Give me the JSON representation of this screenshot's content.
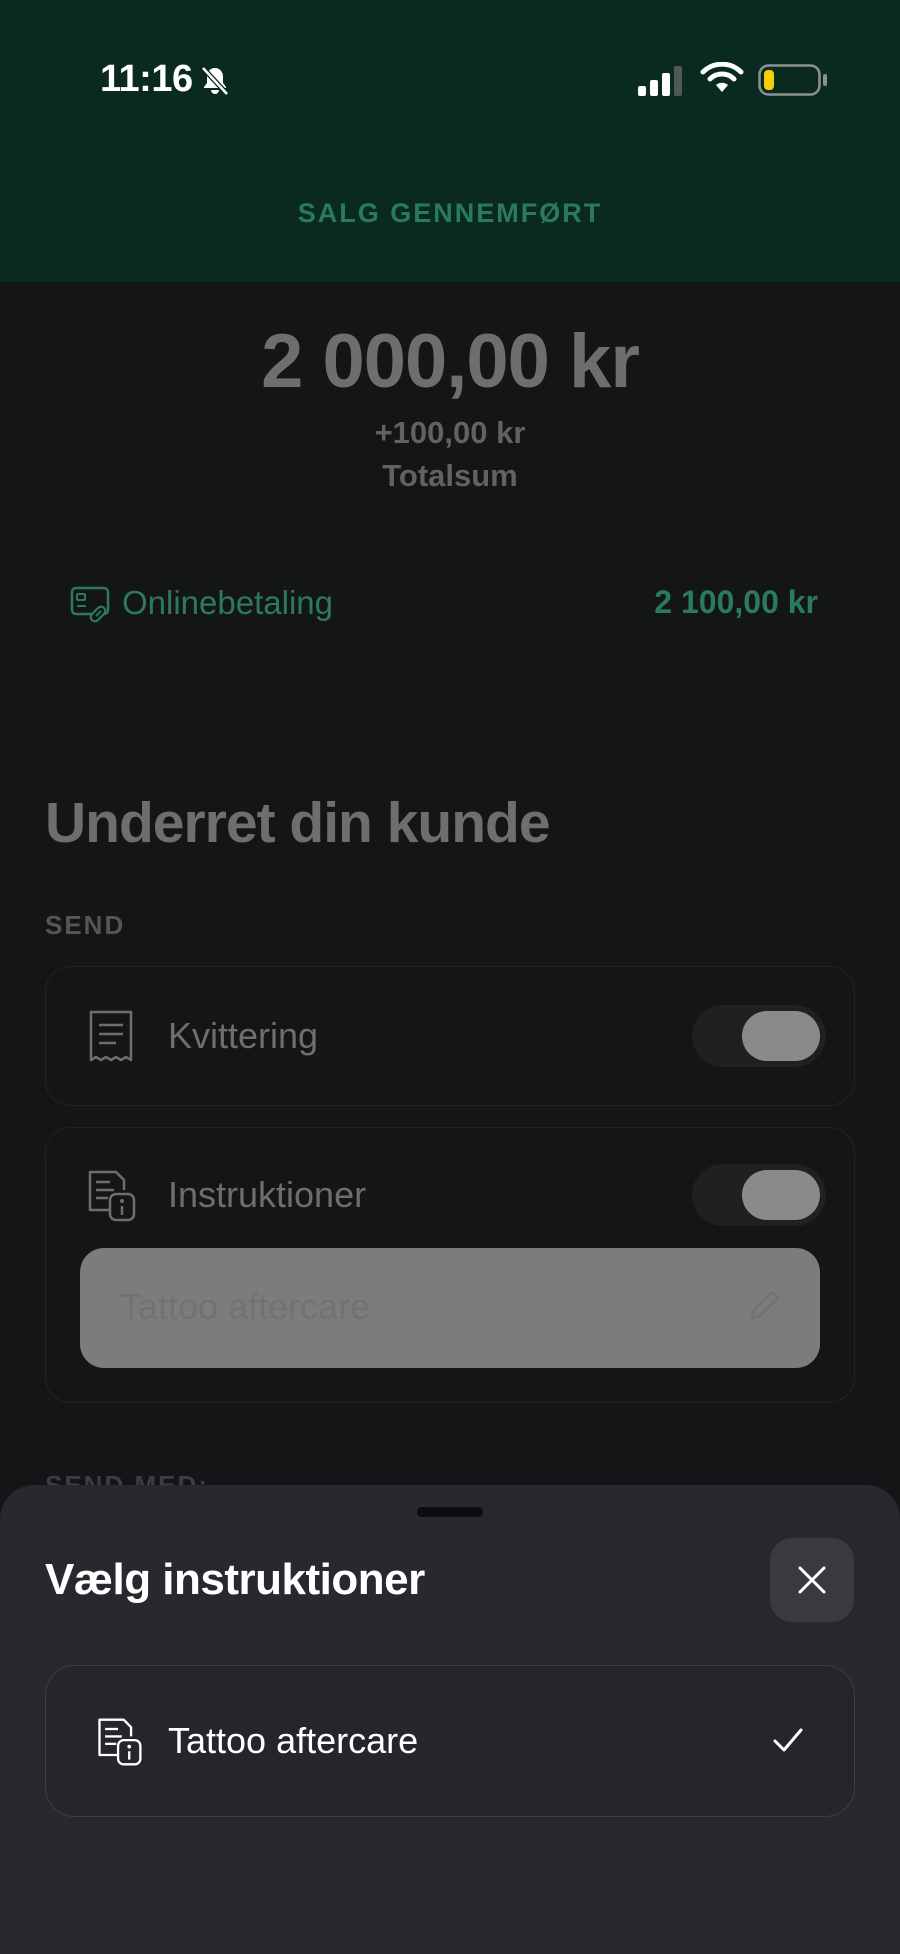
{
  "status_bar": {
    "time": "11:16",
    "icons": [
      "bell-slash-icon",
      "cellular-signal-icon",
      "wifi-icon",
      "battery-low-icon"
    ],
    "battery_color": "#f7ce00"
  },
  "header": {
    "title": "SALG GENNEMFØRT",
    "background": "#0a2a1f",
    "accent": "#2a7a5e"
  },
  "summary": {
    "amount": "2 000,00 kr",
    "tip": "+100,00 kr",
    "total_label": "Totalsum"
  },
  "payment": {
    "icon": "online-payment-icon",
    "label": "Onlinebetaling",
    "amount": "2 100,00 kr"
  },
  "notify": {
    "title": "Underret din kunde",
    "send_label": "SEND",
    "receipt": {
      "icon": "receipt-icon",
      "label": "Kvittering",
      "enabled": true
    },
    "instructions": {
      "icon": "instructions-icon",
      "label": "Instruktioner",
      "enabled": true,
      "selected_value": "Tattoo aftercare",
      "edit_icon": "pencil-icon"
    },
    "send_with_label": "SEND MED:"
  },
  "sheet": {
    "title": "Vælg instruktioner",
    "close_icon": "close-icon",
    "options": [
      {
        "icon": "instructions-icon",
        "label": "Tattoo aftercare",
        "selected": true,
        "check_icon": "checkmark-icon"
      }
    ]
  }
}
